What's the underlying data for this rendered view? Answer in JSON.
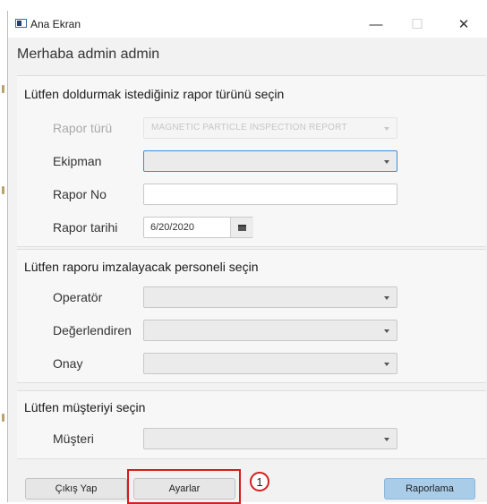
{
  "window": {
    "title": "Ana Ekran",
    "minimize_glyph": "—",
    "maximize_glyph": "☐",
    "close_glyph": "✕"
  },
  "greeting": "Merhaba admin admin",
  "report_section": {
    "title": "Lütfen doldurmak istediğiniz rapor türünü seçin",
    "report_type": {
      "label": "Rapor türü",
      "value": "MAGNETIC PARTICLE INSPECTION REPORT"
    },
    "equipment": {
      "label": "Ekipman",
      "value": ""
    },
    "report_no": {
      "label": "Rapor No",
      "value": ""
    },
    "report_date": {
      "label": "Rapor tarihi",
      "value": "6/20/2020"
    }
  },
  "personnel_section": {
    "title": "Lütfen raporu imzalayacak personeli seçin",
    "operator": {
      "label": "Operatör",
      "value": ""
    },
    "evaluator": {
      "label": "Değerlendiren",
      "value": ""
    },
    "approval": {
      "label": "Onay",
      "value": ""
    }
  },
  "customer_section": {
    "title": "Lütfen müşteriyi seçin",
    "customer": {
      "label": "Müşteri",
      "value": ""
    }
  },
  "footer": {
    "logout_label": "Çıkış Yap",
    "settings_label": "Ayarlar",
    "report_label": "Raporlama"
  },
  "annotation": {
    "step_number": "1",
    "color": "#d21f1f"
  },
  "colors": {
    "focus_border": "#3a8fd6",
    "primary_button": "#a9cce9"
  },
  "icons": [
    "app-window-icon",
    "minimize-icon",
    "maximize-icon",
    "close-icon",
    "calendar-icon",
    "chevron-down-icon"
  ]
}
